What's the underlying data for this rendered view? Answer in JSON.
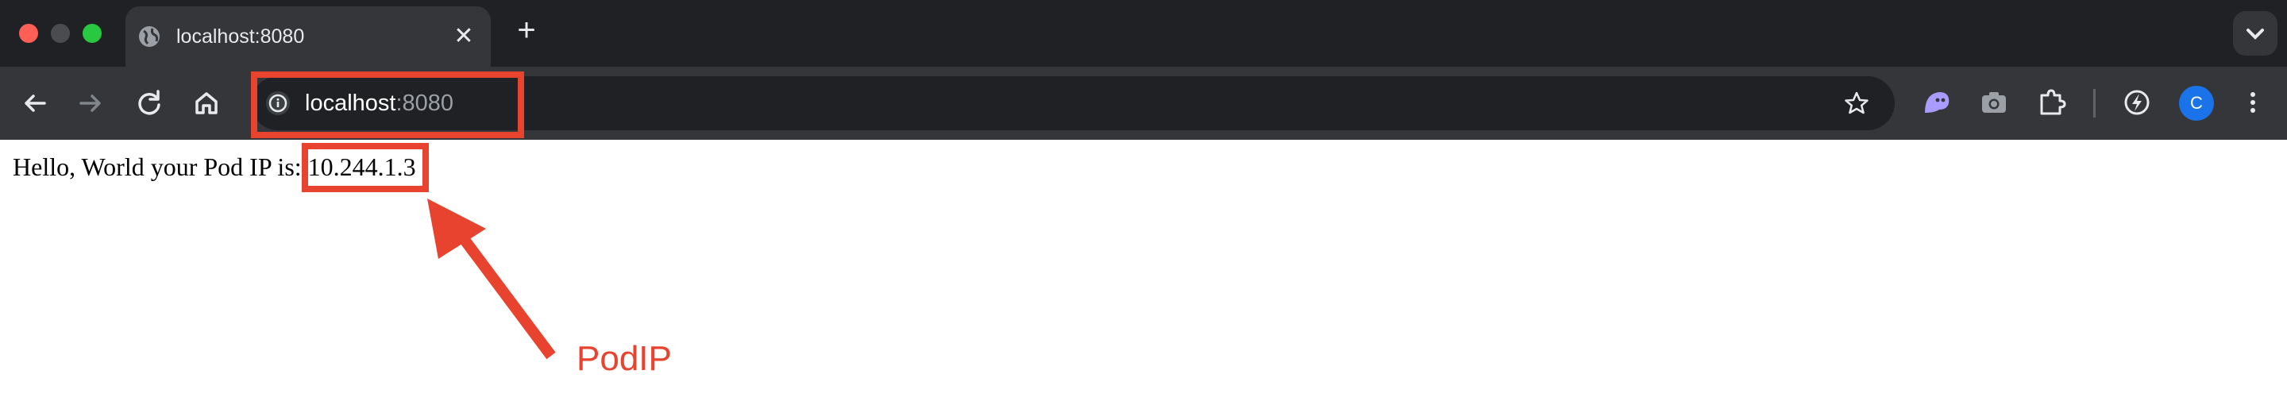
{
  "tab": {
    "title": "localhost:8080",
    "close": "✕"
  },
  "newtab": {
    "label": "+"
  },
  "omnibox": {
    "host": "localhost",
    "port": ":8080"
  },
  "account": {
    "initial": "C"
  },
  "page": {
    "prefix": "Hello, World your Pod IP is: ",
    "ip": "10.244.1.3"
  },
  "annotation": {
    "label": "PodIP",
    "color": "#e8432e"
  },
  "icons": {
    "back": "arrow-left-icon",
    "forward": "arrow-right-icon",
    "reload": "reload-icon",
    "home": "home-icon",
    "info": "info-icon",
    "star": "star-icon",
    "extensions": [
      "ghost-extension-icon",
      "camera-extension-icon",
      "puzzle-icon",
      "speed-extension-icon"
    ],
    "menu": "kebab-menu-icon"
  }
}
